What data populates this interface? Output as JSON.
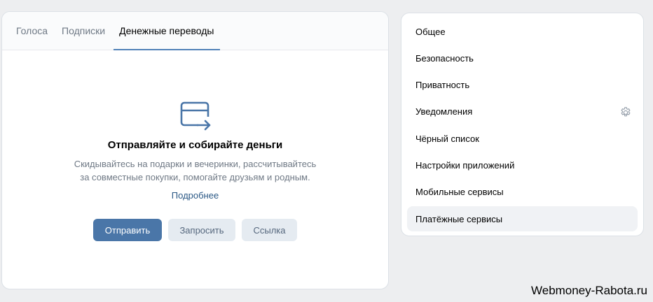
{
  "tabs": [
    {
      "label": "Голоса"
    },
    {
      "label": "Подписки"
    },
    {
      "label": "Денежные переводы"
    }
  ],
  "empty_state": {
    "icon": "card-transfer-icon",
    "title": "Отправляйте и собирайте деньги",
    "description_line1": "Скидывайтесь на подарки и вечеринки, рассчитывайтесь",
    "description_line2": "за совместные покупки, помогайте друзьям и родным.",
    "more_link": "Подробнее"
  },
  "actions": {
    "send": "Отправить",
    "request": "Запросить",
    "link": "Ссылка"
  },
  "settings_menu": [
    {
      "label": "Общее"
    },
    {
      "label": "Безопасность"
    },
    {
      "label": "Приватность"
    },
    {
      "label": "Уведомления",
      "icon": "gear-icon"
    },
    {
      "label": "Чёрный список"
    },
    {
      "label": "Настройки приложений"
    },
    {
      "label": "Мобильные сервисы"
    },
    {
      "label": "Платёжные сервисы",
      "selected": true
    }
  ],
  "watermark": "Webmoney-Rabota.ru",
  "colors": {
    "accent": "#4a76a8",
    "tab_underline": "#5181b8",
    "background": "#edeef0"
  }
}
